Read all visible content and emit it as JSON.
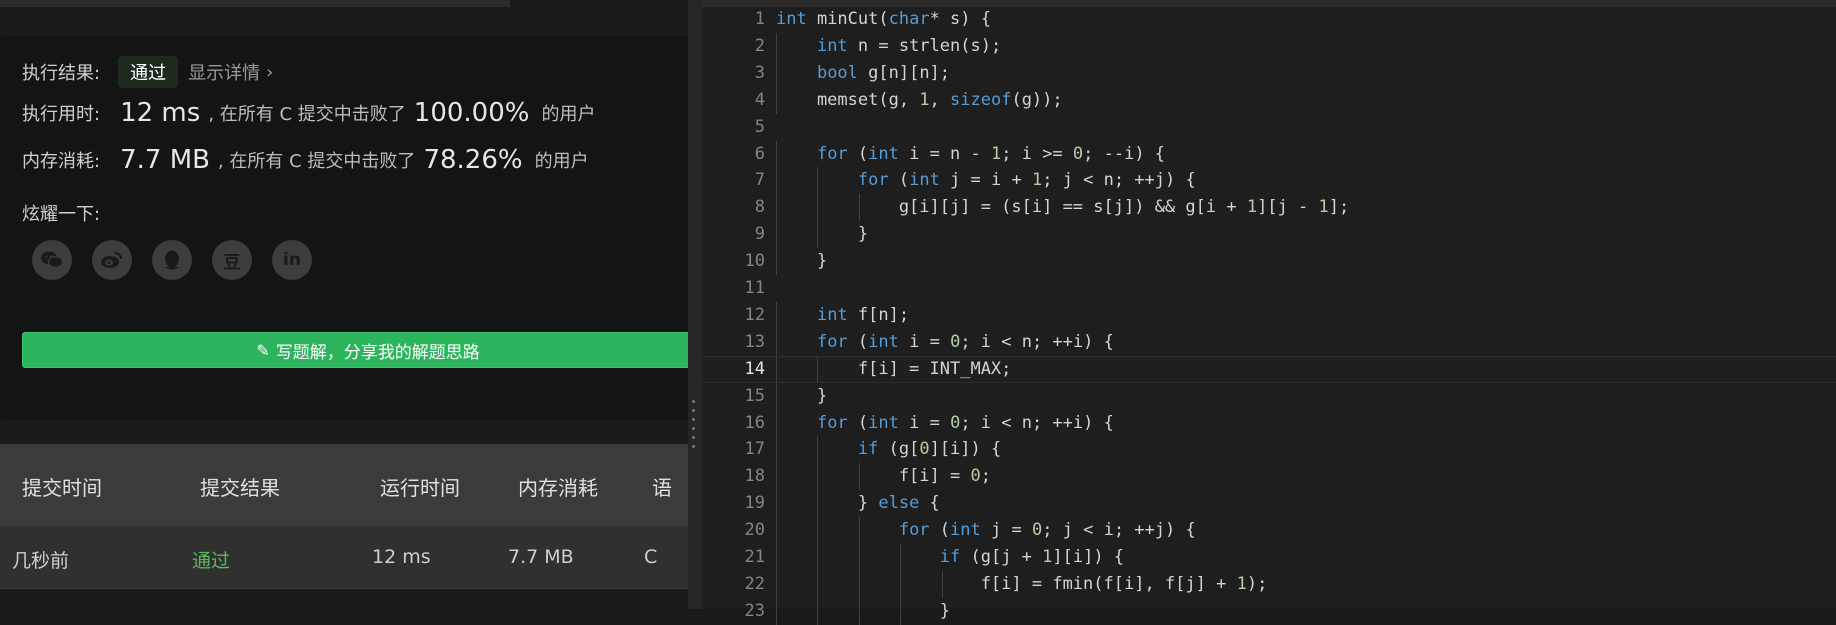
{
  "result": {
    "label": "执行结果:",
    "status": "通过",
    "detail": "显示详情",
    "chevron": "›"
  },
  "runtime": {
    "label": "执行用时:",
    "value": "12 ms",
    "mid": ", 在所有 C 提交中击败了",
    "percent": "100.00%",
    "suffix": "的用户"
  },
  "memory": {
    "label": "内存消耗:",
    "value": "7.7 MB",
    "mid": ", 在所有 C 提交中击败了",
    "percent": "78.26%",
    "suffix": "的用户"
  },
  "share": {
    "label": "炫耀一下:",
    "icons": [
      "wechat-icon",
      "weibo-icon",
      "qq-icon",
      "douban-icon",
      "linkedin-icon"
    ],
    "douban_glyph": "豆",
    "linkedin_glyph": "in"
  },
  "write_button": {
    "icon": "pencil-icon",
    "label": "写题解，分享我的解题思路"
  },
  "table": {
    "headers": [
      "提交时间",
      "提交结果",
      "运行时间",
      "内存消耗",
      "语"
    ],
    "rows": [
      {
        "time": "几秒前",
        "result": "通过",
        "runtime": "12 ms",
        "memory": "7.7 MB",
        "lang": "C"
      }
    ]
  },
  "editor": {
    "current_line": 14,
    "lines": [
      "int minCut(char* s) {",
      "    int n = strlen(s);",
      "    bool g[n][n];",
      "    memset(g, 1, sizeof(g));",
      "",
      "    for (int i = n - 1; i >= 0; --i) {",
      "        for (int j = i + 1; j < n; ++j) {",
      "            g[i][j] = (s[i] == s[j]) && g[i + 1][j - 1];",
      "        }",
      "    }",
      "",
      "    int f[n];",
      "    for (int i = 0; i < n; ++i) {",
      "        f[i] = INT_MAX;",
      "    }",
      "    for (int i = 0; i < n; ++i) {",
      "        if (g[0][i]) {",
      "            f[i] = 0;",
      "        } else {",
      "            for (int j = 0; j < i; ++j) {",
      "                if (g[j + 1][i]) {",
      "                    f[i] = fmin(f[i], f[j] + 1);",
      "                }"
    ]
  },
  "colors": {
    "accent_green": "#2db55d",
    "pass_green": "#5cb85c",
    "keyword_blue": "#569cd6",
    "number_green": "#b5cea8"
  }
}
